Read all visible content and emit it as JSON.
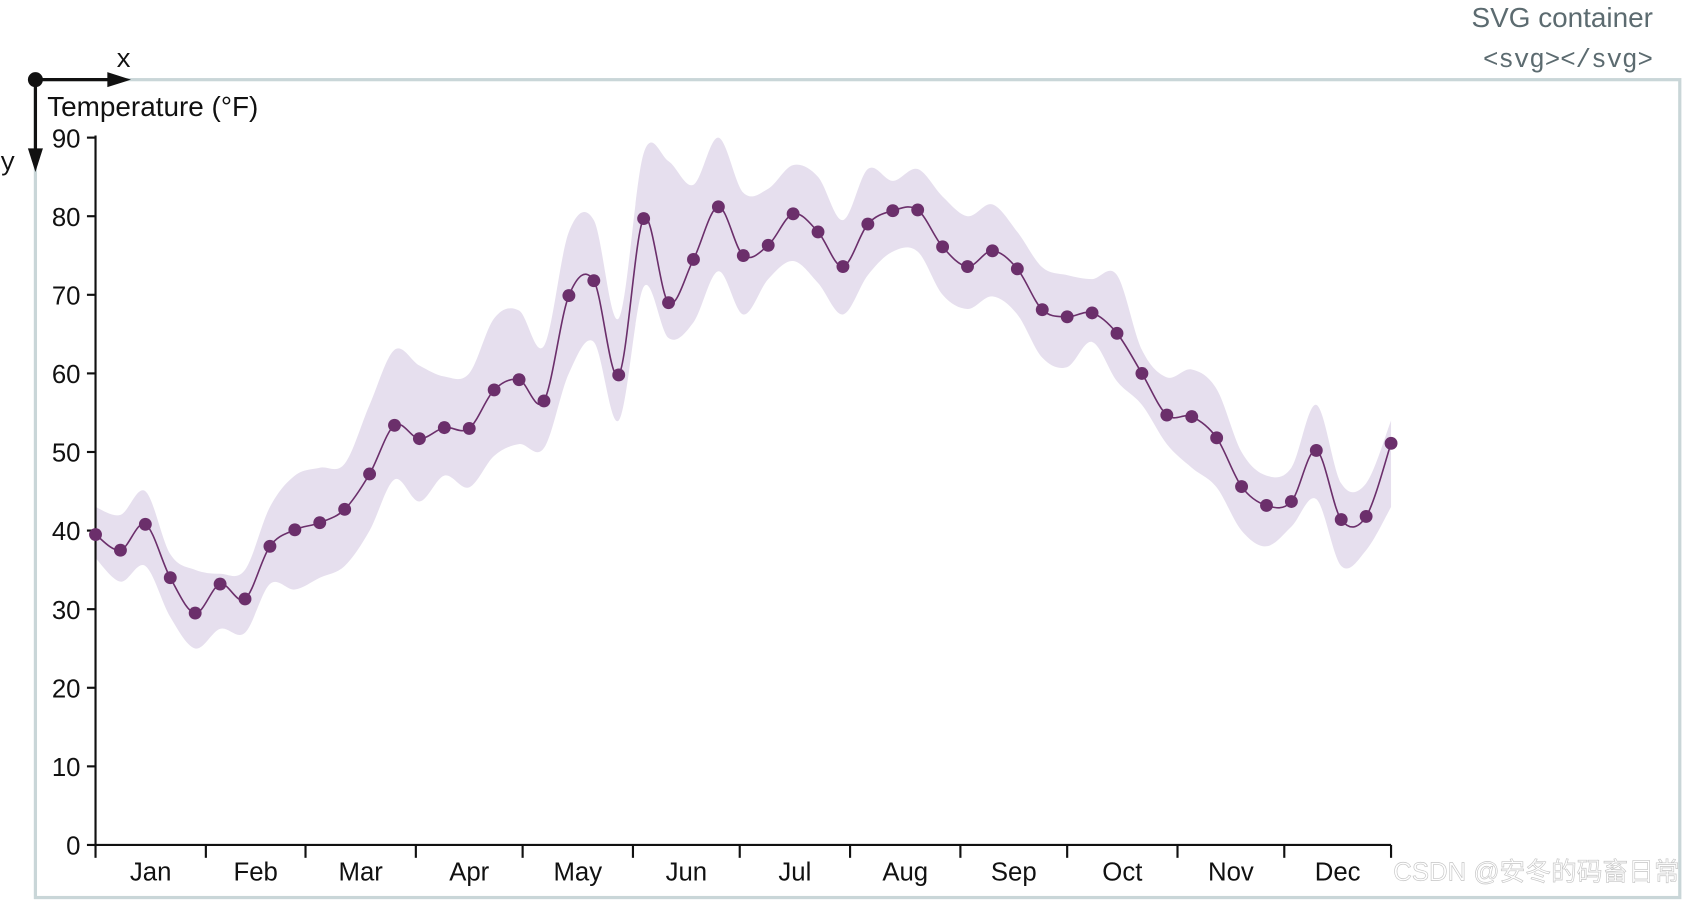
{
  "container": {
    "title": "SVG container",
    "tag": "<svg></svg>",
    "axis_x_label": "x",
    "axis_y_label": "y",
    "frame_color": "#c9d6d8",
    "text_color": "#5c6b70"
  },
  "watermark": "CSDN @安冬的码畜日常",
  "chart_data": {
    "type": "line",
    "ylabel": "Temperature (°F)",
    "xlabel": "",
    "ylim": [
      0,
      90
    ],
    "yticks": [
      0,
      10,
      20,
      30,
      40,
      50,
      60,
      70,
      80,
      90
    ],
    "months": [
      "Jan",
      "Feb",
      "Mar",
      "Apr",
      "May",
      "Jun",
      "Jul",
      "Aug",
      "Sep",
      "Oct",
      "Nov",
      "Dec"
    ],
    "grid": false,
    "line_color": "#6b2f6b",
    "band_color": "#e6dfee",
    "x": [
      "Jan 1",
      "Jan 8",
      "Jan 15",
      "Jan 22",
      "Jan 29",
      "Feb 5",
      "Feb 12",
      "Feb 19",
      "Feb 26",
      "Mar 5",
      "Mar 12",
      "Mar 19",
      "Mar 26",
      "Apr 2",
      "Apr 9",
      "Apr 16",
      "Apr 23",
      "Apr 30",
      "May 7",
      "May 14",
      "May 21",
      "May 28",
      "Jun 4",
      "Jun 11",
      "Jun 18",
      "Jun 25",
      "Jul 2",
      "Jul 9",
      "Jul 16",
      "Jul 23",
      "Jul 30",
      "Aug 6",
      "Aug 13",
      "Aug 20",
      "Aug 27",
      "Sep 3",
      "Sep 10",
      "Sep 17",
      "Sep 24",
      "Oct 1",
      "Oct 8",
      "Oct 15",
      "Oct 22",
      "Oct 29",
      "Nov 5",
      "Nov 12",
      "Nov 19",
      "Nov 26",
      "Dec 3",
      "Dec 10",
      "Dec 17",
      "Dec 24",
      "Dec 31"
    ],
    "series": [
      {
        "values": [
          39.5,
          37.5,
          40.8,
          34,
          29.5,
          33.2,
          31.3,
          38,
          40.1,
          41,
          42.7,
          47.2,
          53.4,
          51.7,
          53.1,
          53,
          57.9,
          59.2,
          56.5,
          69.9,
          71.8,
          59.8,
          79.7,
          69,
          74.5,
          81.2,
          75,
          76.3,
          80.3,
          78,
          73.6,
          79,
          80.7,
          80.8,
          76.1,
          73.6,
          75.6,
          73.3,
          68.1,
          67.2,
          67.7,
          65.1,
          60,
          54.7,
          54.5,
          51.8,
          45.6,
          43.2,
          43.7,
          50.2,
          41.4,
          41.8,
          51.1
        ]
      }
    ],
    "band_upper": [
      43,
      42,
      45,
      37,
      35,
      34.5,
      35,
      43,
      47,
      48,
      48.5,
      56,
      63,
      61,
      59.6,
      60,
      67,
      68,
      63.5,
      78,
      79.5,
      67,
      88,
      87,
      84,
      90,
      83,
      83.5,
      86.5,
      85,
      79.5,
      86,
      84.5,
      86,
      82.5,
      80,
      81.5,
      78,
      73.5,
      72.5,
      72,
      72.5,
      63,
      59.5,
      60.5,
      58,
      50,
      47,
      48,
      56,
      46,
      46,
      54
    ],
    "band_lower": [
      36.5,
      33.5,
      35.5,
      29,
      25,
      27.5,
      27,
      33.2,
      32.5,
      34,
      35.5,
      40,
      46.5,
      43.7,
      47,
      45.5,
      49.5,
      51,
      50.5,
      60,
      64,
      54,
      71,
      64.5,
      66.5,
      73,
      67.5,
      72,
      74.3,
      71.5,
      67.5,
      72.5,
      75.5,
      75.5,
      70,
      68.2,
      69.8,
      67.5,
      62,
      60.8,
      64,
      59,
      56,
      51,
      48,
      45.5,
      40,
      38,
      40.5,
      44,
      35.5,
      37.5,
      43
    ]
  }
}
